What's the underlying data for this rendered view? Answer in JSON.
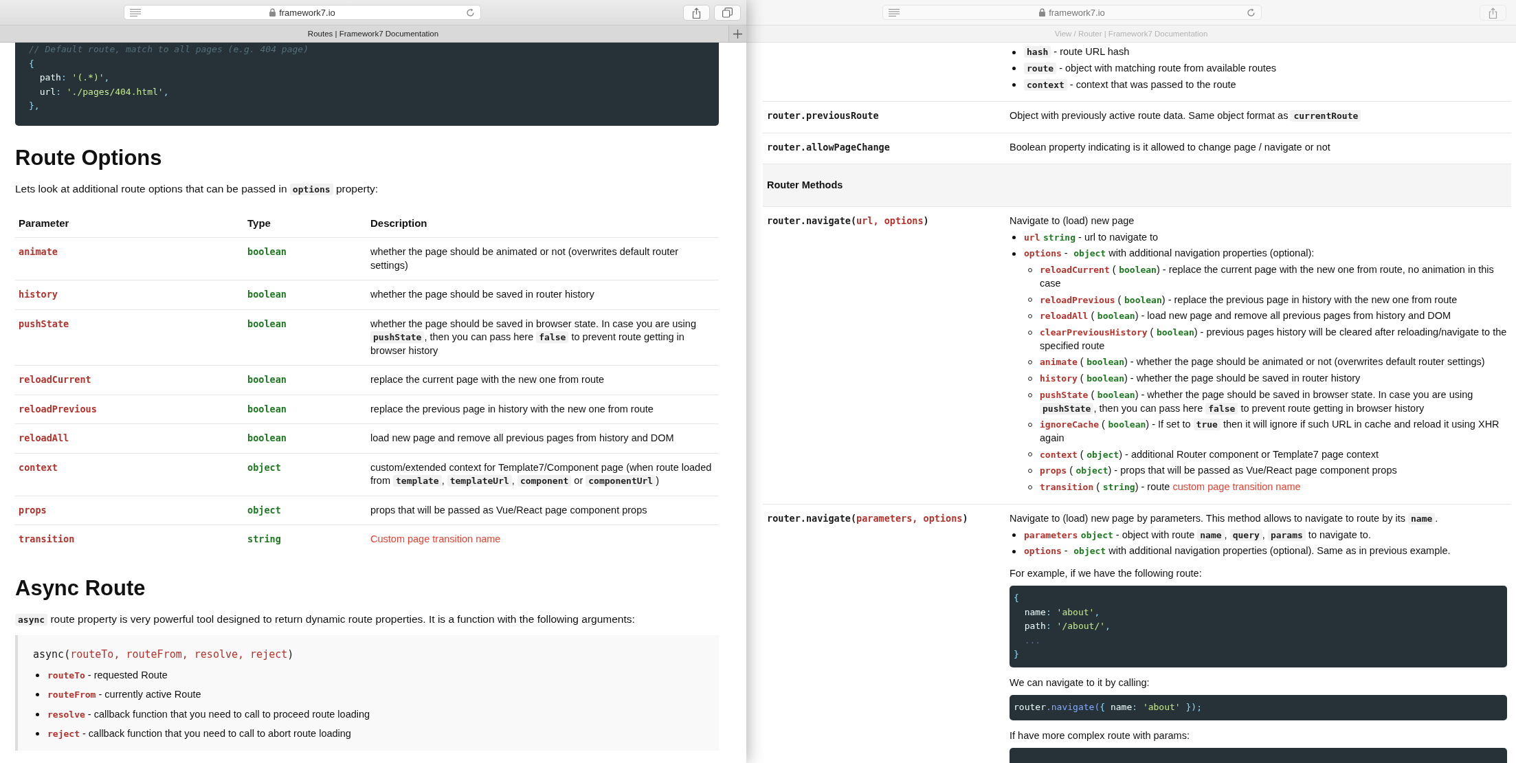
{
  "front_window": {
    "active": true,
    "url": "framework7.io",
    "tab_title": "Routes | Framework7 Documentation",
    "code_lines": [
      {
        "kind": "top",
        "tokens": [
          {
            "kind": "comment",
            "text": "// Default route, match to all pages (e.g. 404 page)"
          }
        ]
      },
      {
        "kind": "top",
        "tokens": [
          {
            "kind": "punct",
            "text": "{"
          }
        ]
      },
      {
        "kind": "inner",
        "tokens": [
          {
            "kind": "key",
            "text": "path"
          },
          {
            "kind": "punct",
            "text": ": "
          },
          {
            "kind": "string",
            "text": "'(.*)'"
          },
          {
            "kind": "punct",
            "text": ","
          }
        ]
      },
      {
        "kind": "inner",
        "tokens": [
          {
            "kind": "key",
            "text": "url"
          },
          {
            "kind": "punct",
            "text": ": "
          },
          {
            "kind": "string",
            "text": "'./pages/404.html'"
          },
          {
            "kind": "punct",
            "text": ","
          }
        ]
      },
      {
        "kind": "top",
        "tokens": [
          {
            "kind": "punct",
            "text": "},"
          }
        ]
      }
    ],
    "heading": "Route Options",
    "intro": [
      {
        "kind": "text",
        "text": "Lets look at additional route options that can be passed in "
      },
      {
        "kind": "code",
        "text": "options"
      },
      {
        "kind": "text",
        "text": " property:"
      }
    ],
    "table": {
      "columns": [
        "Parameter",
        "Type",
        "Description"
      ],
      "rows": [
        {
          "parameter": "animate",
          "type": "boolean",
          "description": [
            {
              "kind": "text",
              "text": "whether the page should be animated or not (overwrites default router settings)"
            }
          ]
        },
        {
          "parameter": "history",
          "type": "boolean",
          "description": [
            {
              "kind": "text",
              "text": "whether the page should be saved in router history"
            }
          ]
        },
        {
          "parameter": "pushState",
          "type": "boolean",
          "description": [
            {
              "kind": "text",
              "text": "whether the page should be saved in browser state. In case you are using "
            },
            {
              "kind": "code",
              "text": "pushState"
            },
            {
              "kind": "text",
              "text": ", then you can pass here "
            },
            {
              "kind": "code",
              "text": "false"
            },
            {
              "kind": "text",
              "text": " to prevent route getting in browser history"
            }
          ]
        },
        {
          "parameter": "reloadCurrent",
          "type": "boolean",
          "description": [
            {
              "kind": "text",
              "text": "replace the current page with the new one from route"
            }
          ]
        },
        {
          "parameter": "reloadPrevious",
          "type": "boolean",
          "description": [
            {
              "kind": "text",
              "text": "replace the previous page in history with the new one from route"
            }
          ]
        },
        {
          "parameter": "reloadAll",
          "type": "boolean",
          "description": [
            {
              "kind": "text",
              "text": "load new page and remove all previous pages from history and DOM"
            }
          ]
        },
        {
          "parameter": "context",
          "type": "object",
          "description": [
            {
              "kind": "text",
              "text": "custom/extended context for Template7/Component page (when route loaded from "
            },
            {
              "kind": "code",
              "text": "template"
            },
            {
              "kind": "text",
              "text": ", "
            },
            {
              "kind": "code",
              "text": "templateUrl"
            },
            {
              "kind": "text",
              "text": ", "
            },
            {
              "kind": "code",
              "text": "component"
            },
            {
              "kind": "text",
              "text": " or "
            },
            {
              "kind": "code",
              "text": "componentUrl"
            },
            {
              "kind": "text",
              "text": ")"
            }
          ]
        },
        {
          "parameter": "props",
          "type": "object",
          "description": [
            {
              "kind": "text",
              "text": "props that will be passed as Vue/React page component props"
            }
          ]
        },
        {
          "parameter": "transition",
          "type": "string",
          "description": [
            {
              "kind": "link",
              "text": "Custom page transition name"
            }
          ]
        }
      ]
    },
    "heading_2": "Async Route",
    "paragraph": [
      {
        "kind": "code",
        "text": "async"
      },
      {
        "kind": "text",
        "text": " route property is very powerful tool designed to return dynamic route properties. It is a function with the following arguments:"
      }
    ],
    "signature": [
      {
        "kind": "mono",
        "text": "async("
      },
      {
        "kind": "param",
        "text": "routeTo, routeFrom, resolve, reject"
      },
      {
        "kind": "mono",
        "text": ")"
      }
    ],
    "arguments": [
      {
        "segments": [
          {
            "kind": "param",
            "text": "routeTo"
          },
          {
            "kind": "text",
            "text": " - requested Route"
          }
        ]
      },
      {
        "segments": [
          {
            "kind": "param",
            "text": "routeFrom"
          },
          {
            "kind": "text",
            "text": " - currently active Route"
          }
        ]
      },
      {
        "segments": [
          {
            "kind": "param",
            "text": "resolve"
          },
          {
            "kind": "text",
            "text": " - callback function that you need to call to proceed route loading"
          }
        ]
      },
      {
        "segments": [
          {
            "kind": "param",
            "text": "reject"
          },
          {
            "kind": "text",
            "text": " - callback function that you need to call to abort route loading"
          }
        ]
      }
    ]
  },
  "back_window": {
    "active": false,
    "url": "framework7.io",
    "tab_title": "View / Router | Framework7 Documentation",
    "rows": [
      {
        "kind": "row",
        "content": [
          {
            "kind": "list",
            "items": [
              {
                "segments": [
                  {
                    "kind": "code",
                    "text": "hash"
                  },
                  {
                    "kind": "text",
                    "text": " - route URL hash"
                  }
                ]
              },
              {
                "segments": [
                  {
                    "kind": "code",
                    "text": "route"
                  },
                  {
                    "kind": "text",
                    "text": " - object with matching route from available routes"
                  }
                ]
              },
              {
                "segments": [
                  {
                    "kind": "code",
                    "text": "context"
                  },
                  {
                    "kind": "text",
                    "text": " - context that was passed to the route"
                  }
                ]
              }
            ]
          }
        ]
      },
      {
        "kind": "row",
        "name": [
          {
            "kind": "mono",
            "text": "router.previousRoute"
          }
        ],
        "content": [
          {
            "kind": "paragraph",
            "segments": [
              {
                "kind": "text",
                "text": "Object with previously active route data. Same object format as "
              },
              {
                "kind": "code",
                "text": "currentRoute"
              }
            ]
          }
        ]
      },
      {
        "kind": "row",
        "name": [
          {
            "kind": "mono",
            "text": "router.allowPageChange"
          }
        ],
        "content": [
          {
            "kind": "paragraph",
            "segments": [
              {
                "kind": "text",
                "text": "Boolean property indicating is it allowed to change page / navigate or not"
              }
            ]
          }
        ]
      },
      {
        "kind": "section",
        "title": "Router Methods"
      },
      {
        "kind": "row",
        "name": [
          {
            "kind": "mono",
            "text": "router.navigate("
          },
          {
            "kind": "param",
            "text": "url, options"
          },
          {
            "kind": "mono",
            "text": ")"
          }
        ],
        "content": [
          {
            "kind": "paragraph",
            "segments": [
              {
                "kind": "text",
                "text": "Navigate to (load) new page"
              }
            ]
          },
          {
            "kind": "list",
            "items": [
              {
                "segments": [
                  {
                    "kind": "param",
                    "text": "url"
                  },
                  {
                    "kind": "type",
                    "text": "string"
                  },
                  {
                    "kind": "text",
                    "text": " - url to navigate to"
                  }
                ]
              },
              {
                "segments": [
                  {
                    "kind": "param",
                    "text": "options"
                  },
                  {
                    "kind": "text",
                    "text": " - "
                  },
                  {
                    "kind": "type",
                    "text": "object"
                  },
                  {
                    "kind": "text",
                    "text": " with additional navigation properties (optional):"
                  }
                ],
                "children": [
                  {
                    "segments": [
                      {
                        "kind": "param",
                        "text": "reloadCurrent"
                      },
                      {
                        "kind": "text",
                        "text": " ("
                      },
                      {
                        "kind": "type",
                        "text": "boolean"
                      },
                      {
                        "kind": "text",
                        "text": ") - replace the current page with the new one from route, no animation in this case"
                      }
                    ]
                  },
                  {
                    "segments": [
                      {
                        "kind": "param",
                        "text": "reloadPrevious"
                      },
                      {
                        "kind": "text",
                        "text": " ("
                      },
                      {
                        "kind": "type",
                        "text": "boolean"
                      },
                      {
                        "kind": "text",
                        "text": ") - replace the previous page in history with the new one from route"
                      }
                    ]
                  },
                  {
                    "segments": [
                      {
                        "kind": "param",
                        "text": "reloadAll"
                      },
                      {
                        "kind": "text",
                        "text": " ("
                      },
                      {
                        "kind": "type",
                        "text": "boolean"
                      },
                      {
                        "kind": "text",
                        "text": ") - load new page and remove all previous pages from history and DOM"
                      }
                    ]
                  },
                  {
                    "segments": [
                      {
                        "kind": "param",
                        "text": "clearPreviousHistory"
                      },
                      {
                        "kind": "text",
                        "text": " ("
                      },
                      {
                        "kind": "type",
                        "text": "boolean"
                      },
                      {
                        "kind": "text",
                        "text": ") - previous pages history will be cleared after reloading/navigate to the specified route"
                      }
                    ]
                  },
                  {
                    "segments": [
                      {
                        "kind": "param",
                        "text": "animate"
                      },
                      {
                        "kind": "text",
                        "text": " ("
                      },
                      {
                        "kind": "type",
                        "text": "boolean"
                      },
                      {
                        "kind": "text",
                        "text": ") - whether the page should be animated or not (overwrites default router settings)"
                      }
                    ]
                  },
                  {
                    "segments": [
                      {
                        "kind": "param",
                        "text": "history"
                      },
                      {
                        "kind": "text",
                        "text": " ("
                      },
                      {
                        "kind": "type",
                        "text": "boolean"
                      },
                      {
                        "kind": "text",
                        "text": ") - whether the page should be saved in router history"
                      }
                    ]
                  },
                  {
                    "segments": [
                      {
                        "kind": "param",
                        "text": "pushState"
                      },
                      {
                        "kind": "text",
                        "text": " ("
                      },
                      {
                        "kind": "type",
                        "text": "boolean"
                      },
                      {
                        "kind": "text",
                        "text": ") - whether the page should be saved in browser state. In case you are using "
                      },
                      {
                        "kind": "code",
                        "text": "pushState"
                      },
                      {
                        "kind": "text",
                        "text": ", then you can pass here "
                      },
                      {
                        "kind": "code",
                        "text": "false"
                      },
                      {
                        "kind": "text",
                        "text": " to prevent route getting in browser history"
                      }
                    ]
                  },
                  {
                    "segments": [
                      {
                        "kind": "param",
                        "text": "ignoreCache"
                      },
                      {
                        "kind": "text",
                        "text": " ("
                      },
                      {
                        "kind": "type",
                        "text": "boolean"
                      },
                      {
                        "kind": "text",
                        "text": ") - If set to "
                      },
                      {
                        "kind": "code",
                        "text": "true"
                      },
                      {
                        "kind": "text",
                        "text": " then it will ignore if such URL in cache and reload it using XHR again"
                      }
                    ]
                  },
                  {
                    "segments": [
                      {
                        "kind": "param",
                        "text": "context"
                      },
                      {
                        "kind": "text",
                        "text": " ("
                      },
                      {
                        "kind": "type",
                        "text": "object"
                      },
                      {
                        "kind": "text",
                        "text": ") - additional Router component or Template7 page context"
                      }
                    ]
                  },
                  {
                    "segments": [
                      {
                        "kind": "param",
                        "text": "props"
                      },
                      {
                        "kind": "text",
                        "text": " ("
                      },
                      {
                        "kind": "type",
                        "text": "object"
                      },
                      {
                        "kind": "text",
                        "text": ") - props that will be passed as Vue/React page component props"
                      }
                    ]
                  },
                  {
                    "segments": [
                      {
                        "kind": "param",
                        "text": "transition"
                      },
                      {
                        "kind": "text",
                        "text": " ("
                      },
                      {
                        "kind": "type",
                        "text": "string"
                      },
                      {
                        "kind": "text",
                        "text": ") - route "
                      },
                      {
                        "kind": "link",
                        "text": "custom page transition name"
                      }
                    ]
                  }
                ]
              }
            ]
          }
        ]
      },
      {
        "kind": "row",
        "name": [
          {
            "kind": "mono",
            "text": "router.navigate("
          },
          {
            "kind": "param",
            "text": "parameters, options"
          },
          {
            "kind": "mono",
            "text": ")"
          }
        ],
        "content": [
          {
            "kind": "paragraph",
            "segments": [
              {
                "kind": "text",
                "text": "Navigate to (load) new page by parameters. This method allows to navigate to route by its "
              },
              {
                "kind": "code",
                "text": "name"
              },
              {
                "kind": "text",
                "text": "."
              }
            ]
          },
          {
            "kind": "list",
            "items": [
              {
                "segments": [
                  {
                    "kind": "param",
                    "text": "parameters"
                  },
                  {
                    "kind": "type",
                    "text": "object"
                  },
                  {
                    "kind": "text",
                    "text": " - object with route "
                  },
                  {
                    "kind": "code",
                    "text": "name"
                  },
                  {
                    "kind": "text",
                    "text": ", "
                  },
                  {
                    "kind": "code",
                    "text": "query"
                  },
                  {
                    "kind": "text",
                    "text": ", "
                  },
                  {
                    "kind": "code",
                    "text": "params"
                  },
                  {
                    "kind": "text",
                    "text": " to navigate to."
                  }
                ]
              },
              {
                "segments": [
                  {
                    "kind": "param",
                    "text": "options"
                  },
                  {
                    "kind": "text",
                    "text": " - "
                  },
                  {
                    "kind": "type",
                    "text": "object"
                  },
                  {
                    "kind": "text",
                    "text": " with additional navigation properties (optional). Same as in previous example."
                  }
                ]
              }
            ]
          },
          {
            "kind": "paragraph",
            "segments": [
              {
                "kind": "text",
                "text": "For example, if we have the following route:"
              }
            ]
          },
          {
            "kind": "code",
            "lines": [
              {
                "kind": "top",
                "tokens": [
                  {
                    "kind": "punct",
                    "text": "{"
                  }
                ]
              },
              {
                "kind": "inner",
                "tokens": [
                  {
                    "kind": "key",
                    "text": "name"
                  },
                  {
                    "kind": "punct",
                    "text": ": "
                  },
                  {
                    "kind": "string",
                    "text": "'about'"
                  },
                  {
                    "kind": "punct",
                    "text": ","
                  }
                ]
              },
              {
                "kind": "inner",
                "tokens": [
                  {
                    "kind": "key",
                    "text": "path"
                  },
                  {
                    "kind": "punct",
                    "text": ": "
                  },
                  {
                    "kind": "string",
                    "text": "'/about/'"
                  },
                  {
                    "kind": "punct",
                    "text": ","
                  }
                ]
              },
              {
                "kind": "inner",
                "tokens": [
                  {
                    "kind": "muted",
                    "text": "..."
                  }
                ]
              },
              {
                "kind": "top",
                "tokens": [
                  {
                    "kind": "punct",
                    "text": "}"
                  }
                ]
              }
            ]
          },
          {
            "kind": "paragraph",
            "segments": [
              {
                "kind": "text",
                "text": "We can navigate to it by calling:"
              }
            ]
          },
          {
            "kind": "code",
            "lines": [
              {
                "kind": "top",
                "tokens": [
                  {
                    "kind": "key",
                    "text": "router"
                  },
                  {
                    "kind": "method",
                    "text": ".navigate("
                  },
                  {
                    "kind": "punct",
                    "text": "{ "
                  },
                  {
                    "kind": "key",
                    "text": "name"
                  },
                  {
                    "kind": "punct",
                    "text": ": "
                  },
                  {
                    "kind": "string",
                    "text": "'about'"
                  },
                  {
                    "kind": "punct",
                    "text": " });"
                  }
                ]
              }
            ]
          },
          {
            "kind": "paragraph",
            "segments": [
              {
                "kind": "text",
                "text": "If have more complex route with params:"
              }
            ]
          },
          {
            "kind": "code_stub"
          }
        ]
      }
    ]
  }
}
